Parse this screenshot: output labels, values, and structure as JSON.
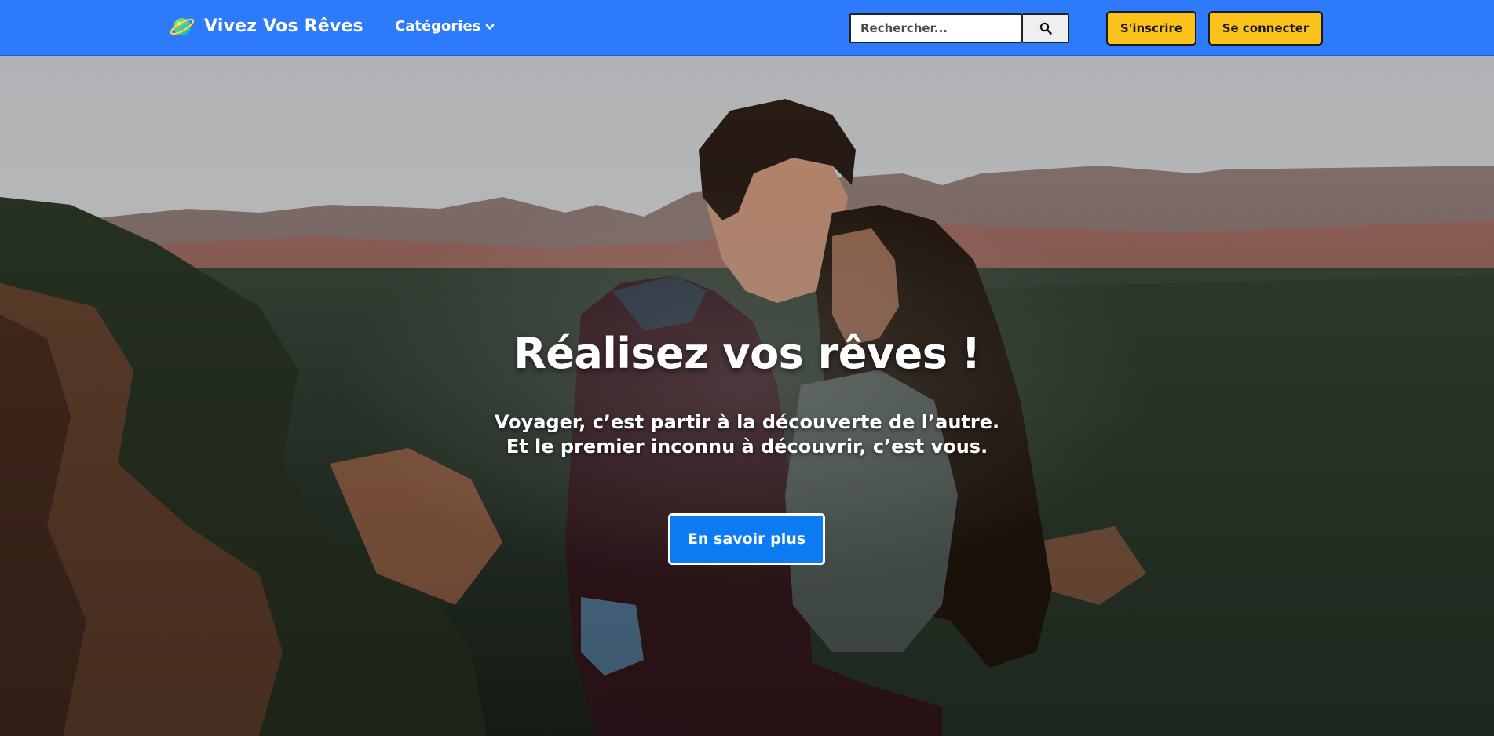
{
  "navbar": {
    "brand": "Vivez Vos Rêves",
    "brand_icon": "planet-icon",
    "categories_label": "Catégories",
    "search_placeholder": "Rechercher...",
    "search_icon": "search-icon",
    "signup_label": "S'inscrire",
    "login_label": "Se connecter",
    "colors": {
      "background": "#2d7bfa",
      "button": "#fbc21b"
    }
  },
  "hero": {
    "title": "Réalisez vos rêves !",
    "subtitle_line1": "Voyager, c’est partir à la découverte de l’autre.",
    "subtitle_line2": "Et le premier inconnu à découvrir, c’est vous.",
    "cta_label": "En savoir plus",
    "colors": {
      "cta": "#0d7bf2"
    }
  }
}
